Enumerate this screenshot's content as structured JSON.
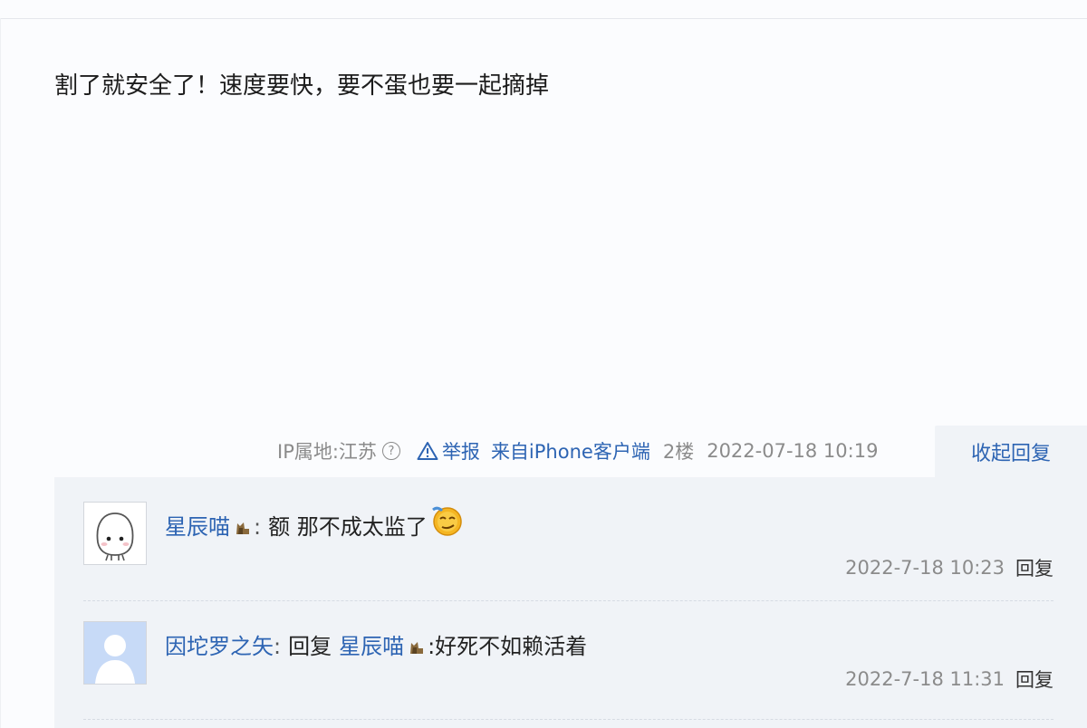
{
  "post": {
    "content": "割了就安全了！速度要快，要不蛋也要一起摘掉",
    "meta": {
      "ip_location": "IP属地:江苏",
      "report_label": "举报",
      "client": "来自iPhone客户端",
      "floor": "2楼",
      "time": "2022-07-18 10:19"
    },
    "toggle_replies_label": "收起回复"
  },
  "replies": [
    {
      "username": "星辰喵",
      "text": "额 那不成太监了",
      "time": "2022-7-18 10:23",
      "reply_label": "回复",
      "icons": [
        "cat-badge-icon",
        "smug-face-emoji-icon"
      ]
    },
    {
      "username": "因坨罗之矢",
      "reply_word": "回复",
      "reply_to": "星辰喵",
      "text": ":好死不如赖活着",
      "time": "2022-7-18 11:31",
      "reply_label": "回复",
      "icons": [
        "default-avatar-icon",
        "cat-badge-icon"
      ]
    }
  ],
  "colors": {
    "link": "#2d64b3",
    "meta_text": "#8b8b8b",
    "reply_bg": "#f0f3f7"
  }
}
